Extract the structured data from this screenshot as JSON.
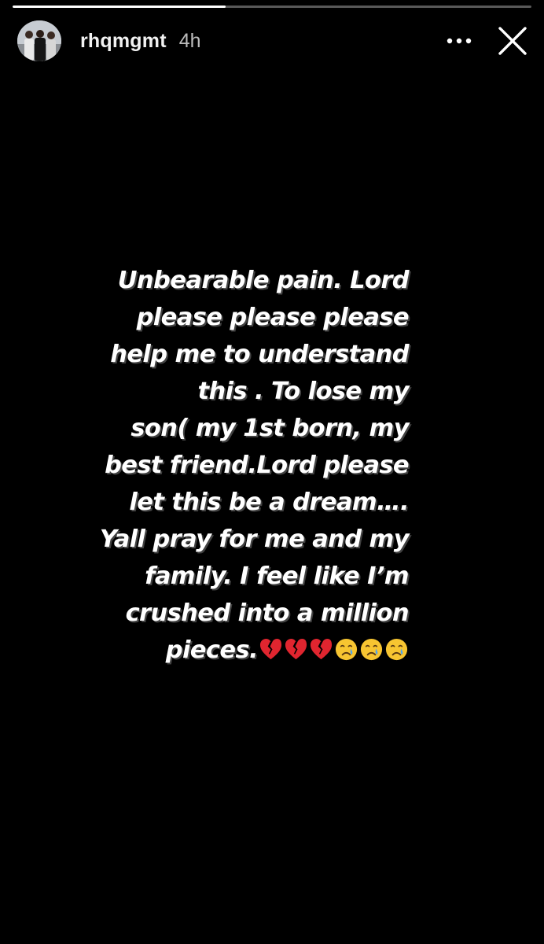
{
  "story": {
    "progress": 0.41,
    "progress_color": "#ffffff"
  },
  "header": {
    "avatar": "profile-photo",
    "username": "rhqmgmt",
    "timestamp": "4h",
    "more_icon": "more-horizontal-icon",
    "close_icon": "close-icon"
  },
  "text": {
    "body": "Unbearable pain. Lord\nplease please please\nhelp me to understand\nthis . To lose my\nson( my 1st born, my\nbest friend.Lord please\nlet this be a dream….\nYall pray for me and my\nfamily.  I feel like I’m\ncrushed into a million\npieces.",
    "emojis": [
      "broken-heart-emoji",
      "broken-heart-emoji",
      "broken-heart-emoji",
      "crying-face-emoji",
      "crying-face-emoji",
      "crying-face-emoji"
    ]
  }
}
